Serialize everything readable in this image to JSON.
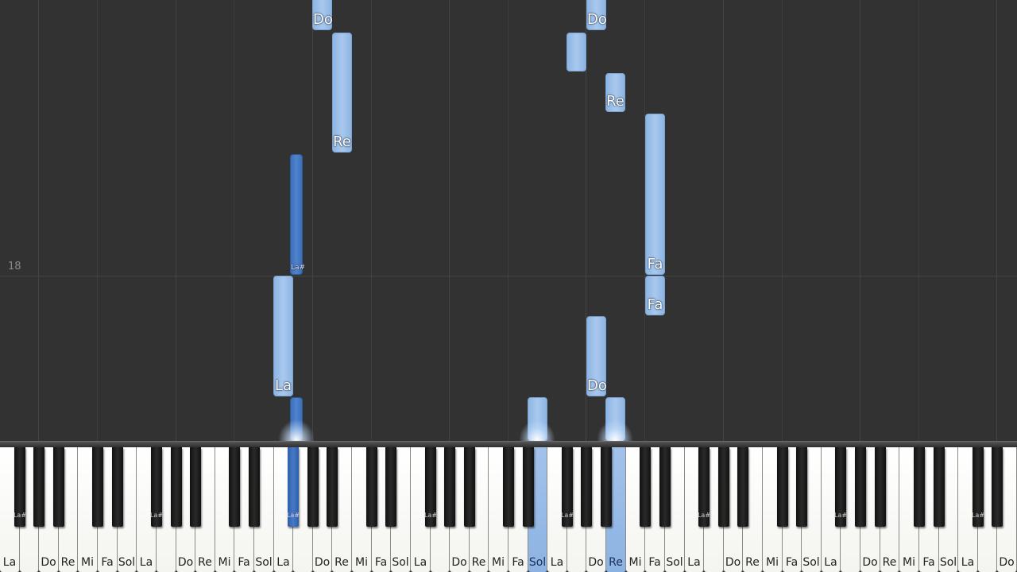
{
  "measure": {
    "number": "18"
  },
  "falling_notes": [
    {
      "label": "Do",
      "kind": "white"
    },
    {
      "label": "Re",
      "kind": "white"
    },
    {
      "label": "La#",
      "kind": "black"
    },
    {
      "label": "La",
      "kind": "white"
    },
    {
      "label": "",
      "kind": "black"
    },
    {
      "label": "",
      "kind": "white"
    },
    {
      "label": "Do",
      "kind": "white"
    },
    {
      "label": "",
      "kind": "white"
    },
    {
      "label": "Re",
      "kind": "white"
    },
    {
      "label": "Fa",
      "kind": "white"
    },
    {
      "label": "Fa",
      "kind": "white"
    },
    {
      "label": "Do",
      "kind": "white"
    },
    {
      "label": "",
      "kind": "white"
    }
  ],
  "keyboard": {
    "white_keys": [
      "La",
      "",
      "Do",
      "Re",
      "Mi",
      "Fa",
      "Sol",
      "La",
      "",
      "Do",
      "Re",
      "Mi",
      "Fa",
      "Sol",
      "La",
      "",
      "Do",
      "Re",
      "Mi",
      "Fa",
      "Sol",
      "La",
      "",
      "Do",
      "Re",
      "Mi",
      "Fa",
      "Sol",
      "La",
      "",
      "Do",
      "Re",
      "Mi",
      "Fa",
      "Sol",
      "La",
      "",
      "Do",
      "Re",
      "Mi",
      "Fa",
      "Sol",
      "La",
      "",
      "Do",
      "Re",
      "Mi",
      "Fa",
      "Sol",
      "La",
      "",
      "Do"
    ],
    "black_key_label": "La#",
    "pressed_white_keys": [
      "Sol",
      "Re"
    ],
    "pressed_black_key": "La#"
  },
  "colors": {
    "background": "#323232",
    "note_white": "#a9c8ee",
    "note_black": "#4f84cf",
    "key_pressed": "#8db3e3"
  }
}
